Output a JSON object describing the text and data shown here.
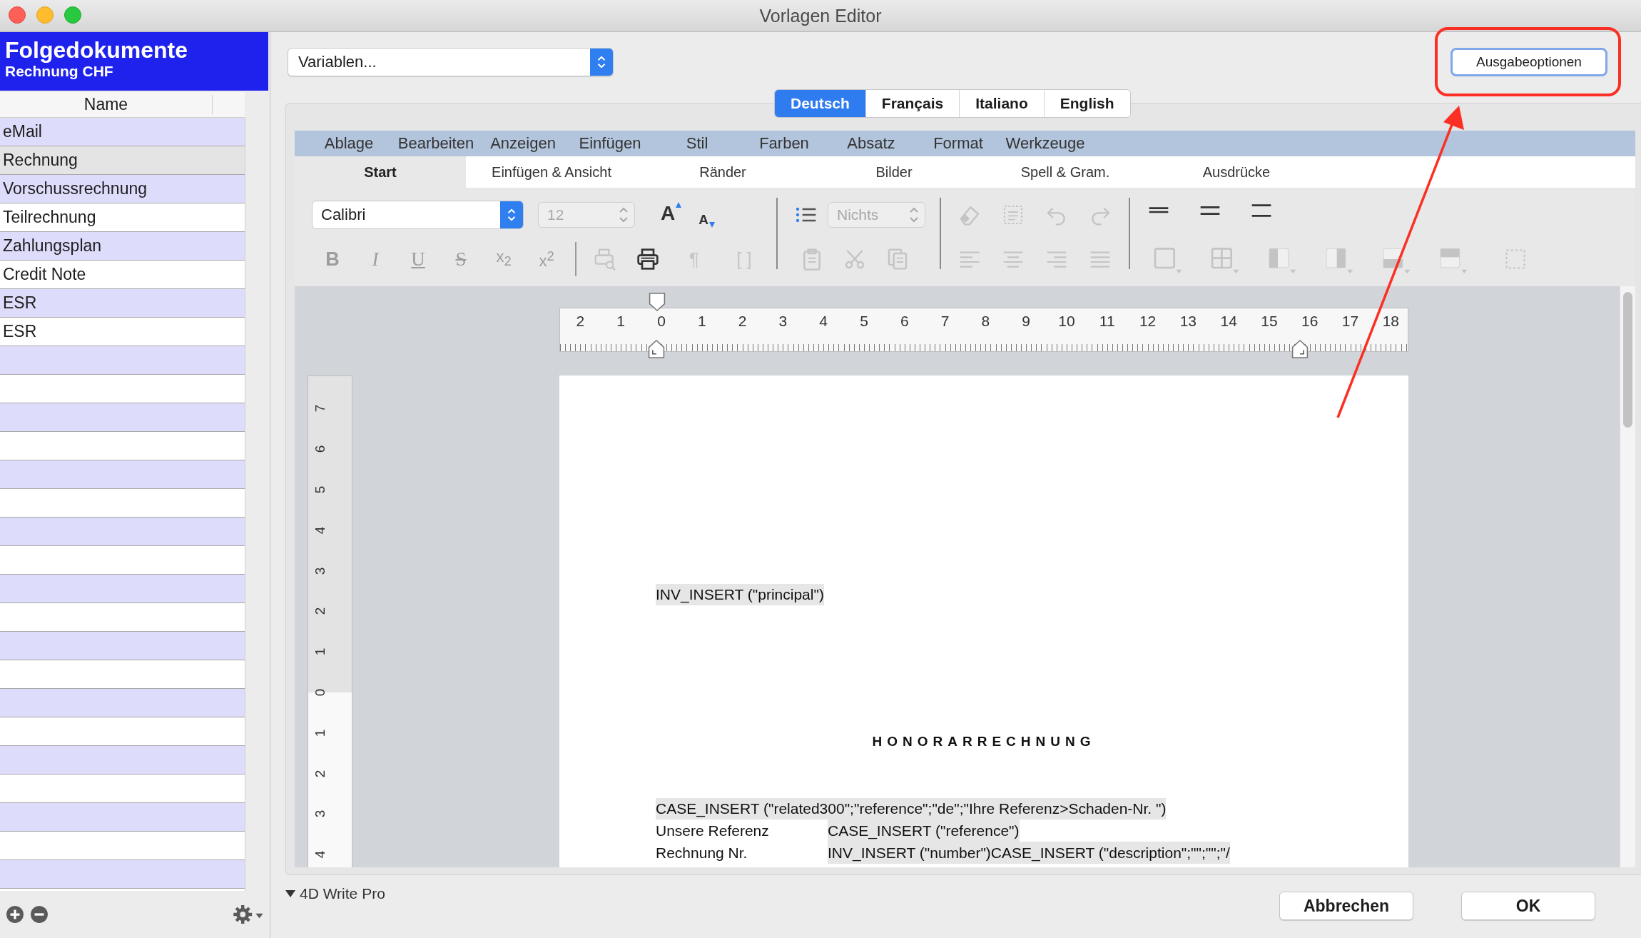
{
  "window": {
    "title": "Vorlagen Editor"
  },
  "sidebar": {
    "title": "Folgedokumente",
    "subtitle": "Rechnung CHF",
    "column": "Name",
    "items": [
      {
        "name": "eMail",
        "selected": false
      },
      {
        "name": "Rechnung",
        "selected": true
      },
      {
        "name": "Vorschussrechnung",
        "selected": false
      },
      {
        "name": "Teilrechnung",
        "selected": false
      },
      {
        "name": "Zahlungsplan",
        "selected": false
      },
      {
        "name": "Credit Note",
        "selected": false
      },
      {
        "name": "ESR",
        "selected": false
      },
      {
        "name": "ESR",
        "selected": false
      }
    ]
  },
  "variables_dropdown": {
    "value": "Variablen..."
  },
  "output_options_button": {
    "label": "Ausgabeoptionen"
  },
  "language_tabs": [
    {
      "label": "Deutsch",
      "selected": true
    },
    {
      "label": "Français",
      "selected": false
    },
    {
      "label": "Italiano",
      "selected": false
    },
    {
      "label": "English",
      "selected": false
    }
  ],
  "menu": [
    "Ablage",
    "Bearbeiten",
    "Anzeigen",
    "Einfügen",
    "Stil",
    "Farben",
    "Absatz",
    "Format",
    "Werkzeuge"
  ],
  "ribbon_tabs": [
    {
      "label": "Start",
      "selected": true
    },
    {
      "label": "Einfügen & Ansicht",
      "selected": false
    },
    {
      "label": "Ränder",
      "selected": false
    },
    {
      "label": "Bilder",
      "selected": false
    },
    {
      "label": "Spell & Gram.",
      "selected": false
    },
    {
      "label": "Ausdrücke",
      "selected": false
    }
  ],
  "ribbon": {
    "font": "Calibri",
    "size": {
      "value": "12",
      "disabled": true
    },
    "font_size_buttons": [
      {
        "label": "A",
        "kind": "grow"
      },
      {
        "label": "A",
        "kind": "shrink"
      }
    ],
    "list_style": {
      "value": "Nichts",
      "disabled": true
    },
    "format_buttons": [
      {
        "label": "B",
        "kind": "bold",
        "disabled": true
      },
      {
        "label": "I",
        "kind": "italic",
        "disabled": true
      },
      {
        "label": "U",
        "kind": "underline",
        "disabled": true
      },
      {
        "label": "S",
        "kind": "strike",
        "disabled": true
      },
      {
        "label": "x$_{2}$",
        "kind": "sub",
        "disabled": true
      },
      {
        "label": "x$^{2}$",
        "kind": "sup",
        "disabled": true
      }
    ],
    "paragraph_buttons": [
      {
        "label": "¶",
        "disabled": true
      },
      {
        "label": "[ ]",
        "disabled": true
      }
    ]
  },
  "ruler": {
    "horizontal": [
      "2",
      "1",
      "0",
      "1",
      "2",
      "3",
      "4",
      "5",
      "6",
      "7",
      "8",
      "9",
      "10",
      "11",
      "12",
      "13",
      "14",
      "15",
      "16",
      "17",
      "18"
    ],
    "vertical": [
      "7",
      "6",
      "5",
      "4",
      "3",
      "2",
      "1",
      "0",
      "1",
      "2",
      "3",
      "4"
    ]
  },
  "document": {
    "lines": [
      {
        "kind": "field",
        "text": "INV_INSERT (\"principal\")"
      },
      {
        "kind": "heading",
        "text": "HONORARRECHNUNG"
      },
      {
        "kind": "field",
        "text": "CASE_INSERT (\"related300\";\"reference\";\"de\";\"Ihre Referenz>Schaden-Nr. \")"
      },
      {
        "kind": "pair",
        "label": "Unsere Referenz",
        "value": "CASE_INSERT (\"reference\")"
      },
      {
        "kind": "pair",
        "label": "Rechnung Nr.",
        "value": "INV_INSERT (\"number\")CASE_INSERT (\"description\";\"\";\"\";\"/"
      }
    ]
  },
  "footer": {
    "section": "4D Write Pro",
    "buttons": [
      {
        "label": "Abbrechen"
      },
      {
        "label": "OK"
      }
    ]
  }
}
